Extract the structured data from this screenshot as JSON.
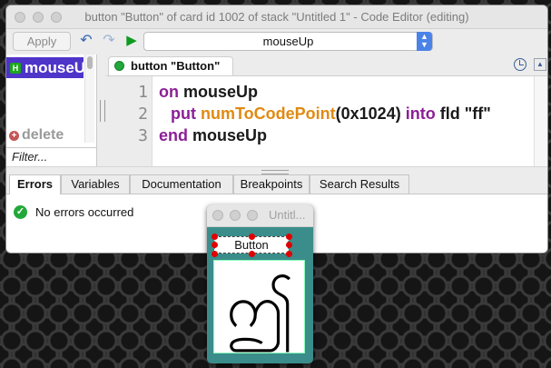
{
  "editor": {
    "title": "button \"Button\" of card id 1002 of stack \"Untitled 1\" - Code Editor (editing)",
    "toolbar": {
      "apply_label": "Apply",
      "handler_select": "mouseUp"
    },
    "handler_list": {
      "items": [
        {
          "label": "mouseUp",
          "badge": "H"
        }
      ],
      "delete_label": "delete",
      "filter_placeholder": "Filter..."
    },
    "script_tab": "button \"Button\"",
    "code": {
      "line_numbers": [
        "1",
        "2",
        "3"
      ],
      "lines": [
        {
          "t1": "on",
          "t2": " mouseUp"
        },
        {
          "t1": "put",
          "t2": " numToCodePoint",
          "t3": "(0x1024) ",
          "t4": "into",
          "t5": " fld \"ff\""
        },
        {
          "t1": "end",
          "t2": " mouseUp"
        }
      ]
    },
    "bottom_tabs": [
      "Errors",
      "Variables",
      "Documentation",
      "Breakpoints",
      "Search Results"
    ],
    "errors_message": "No errors occurred"
  },
  "stack_window": {
    "title": "Untitl...",
    "button_label": "Button",
    "field_glyph": "ဤ"
  },
  "colors": {
    "keyword": "#8c1f96",
    "function": "#e08a12",
    "selection": "#4f34c9",
    "card_bg": "#3a8d8a"
  }
}
